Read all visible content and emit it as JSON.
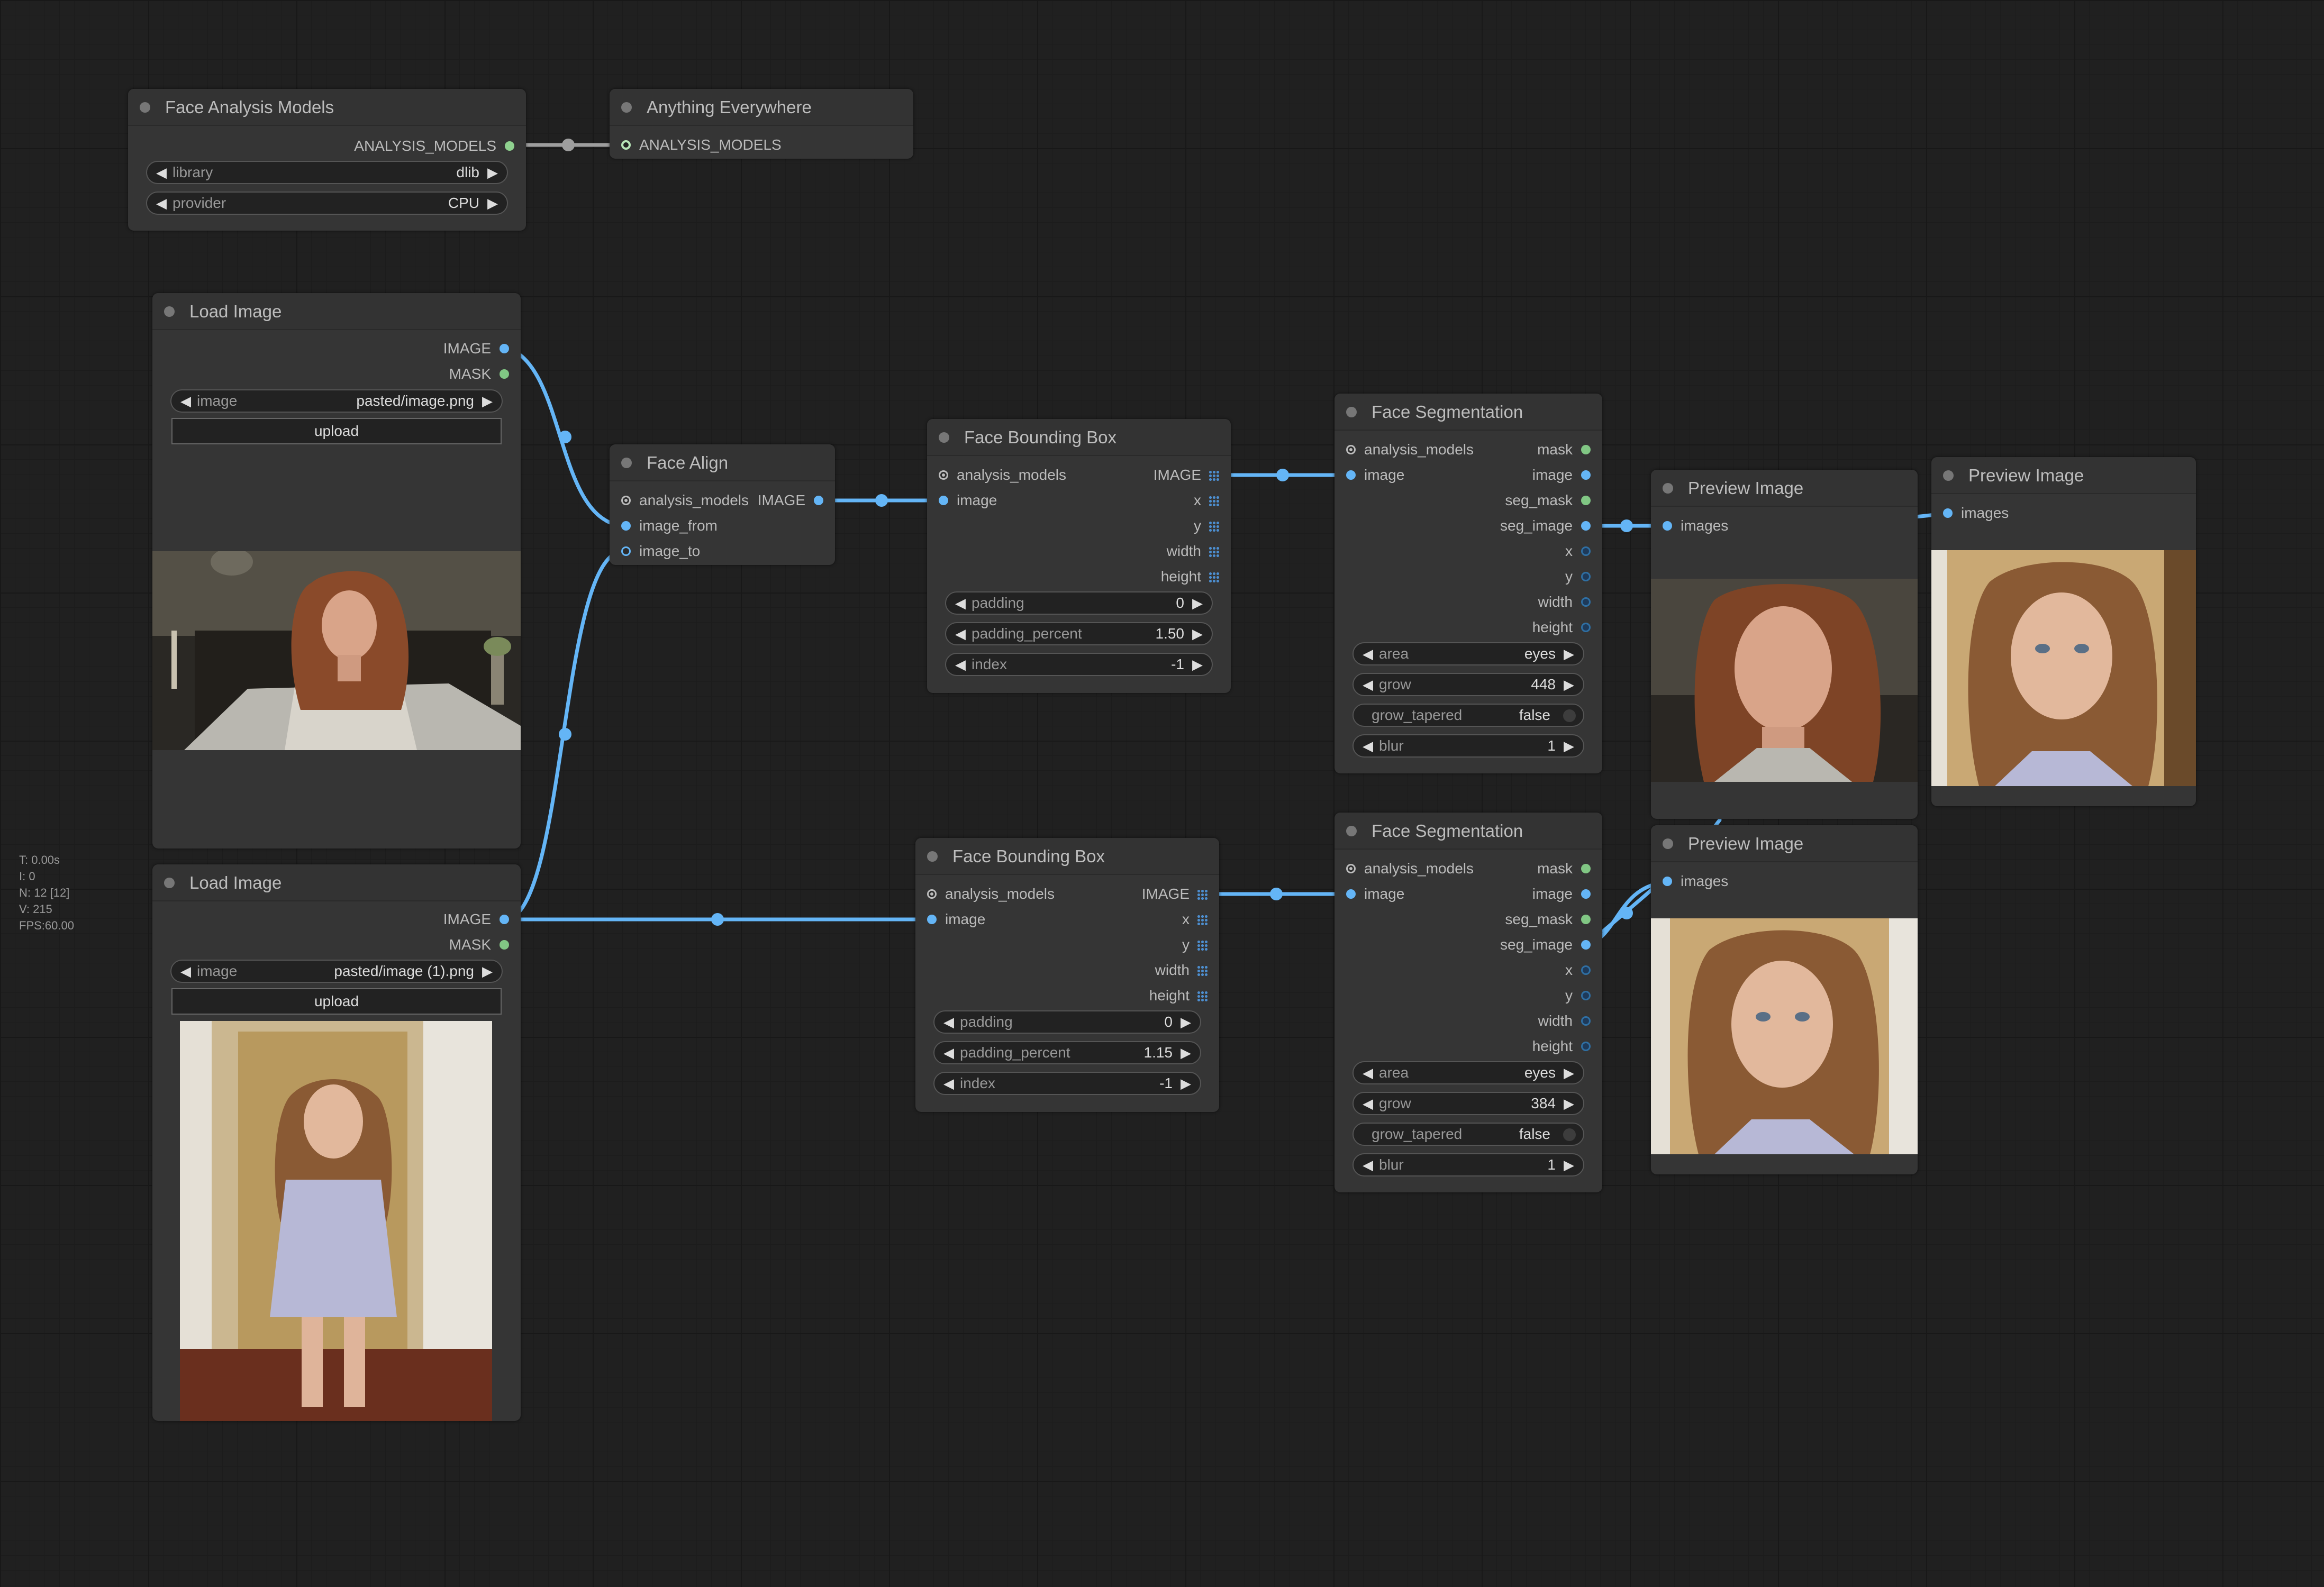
{
  "colors": {
    "canvas": "#202020",
    "node": "#353535",
    "link": "#64b5f6",
    "model_link": "#9e9e9e",
    "image_slot": "#64b5f6",
    "mask_slot": "#81c784"
  },
  "stats": {
    "t": "T: 0.00s",
    "i": "I: 0",
    "n": "N: 12 [12]",
    "v": "V: 215",
    "fps": "FPS:60.00"
  },
  "nodes": {
    "face_models": {
      "title": "Face Analysis Models",
      "output": "ANALYSIS_MODELS",
      "library_label": "library",
      "library_value": "dlib",
      "provider_label": "provider",
      "provider_value": "CPU"
    },
    "anything": {
      "title": "Anything Everywhere",
      "input": "ANALYSIS_MODELS"
    },
    "load1": {
      "title": "Load Image",
      "out_image": "IMAGE",
      "out_mask": "MASK",
      "image_label": "image",
      "image_value": "pasted/image.png",
      "upload": "upload"
    },
    "load2": {
      "title": "Load Image",
      "out_image": "IMAGE",
      "out_mask": "MASK",
      "image_label": "image",
      "image_value": "pasted/image (1).png",
      "upload": "upload"
    },
    "align": {
      "title": "Face Align",
      "in_models": "analysis_models",
      "in_from": "image_from",
      "in_to": "image_to",
      "out_image": "IMAGE"
    },
    "bbox1": {
      "title": "Face Bounding Box",
      "in_models": "analysis_models",
      "in_image": "image",
      "out_image": "IMAGE",
      "out_x": "x",
      "out_y": "y",
      "out_w": "width",
      "out_h": "height",
      "padding_label": "padding",
      "padding_value": "0",
      "pp_label": "padding_percent",
      "pp_value": "1.50",
      "index_label": "index",
      "index_value": "-1"
    },
    "bbox2": {
      "title": "Face Bounding Box",
      "in_models": "analysis_models",
      "in_image": "image",
      "out_image": "IMAGE",
      "out_x": "x",
      "out_y": "y",
      "out_w": "width",
      "out_h": "height",
      "padding_label": "padding",
      "padding_value": "0",
      "pp_label": "padding_percent",
      "pp_value": "1.15",
      "index_label": "index",
      "index_value": "-1"
    },
    "seg1": {
      "title": "Face Segmentation",
      "in_models": "analysis_models",
      "in_image": "image",
      "out_mask": "mask",
      "out_image": "image",
      "out_seg_mask": "seg_mask",
      "out_seg_image": "seg_image",
      "out_x": "x",
      "out_y": "y",
      "out_w": "width",
      "out_h": "height",
      "area_label": "area",
      "area_value": "eyes",
      "grow_label": "grow",
      "grow_value": "448",
      "tapered_label": "grow_tapered",
      "tapered_value": "false",
      "blur_label": "blur",
      "blur_value": "1"
    },
    "seg2": {
      "title": "Face Segmentation",
      "in_models": "analysis_models",
      "in_image": "image",
      "out_mask": "mask",
      "out_image": "image",
      "out_seg_mask": "seg_mask",
      "out_seg_image": "seg_image",
      "out_x": "x",
      "out_y": "y",
      "out_w": "width",
      "out_h": "height",
      "area_label": "area",
      "area_value": "eyes",
      "grow_label": "grow",
      "grow_value": "384",
      "tapered_label": "grow_tapered",
      "tapered_value": "false",
      "blur_label": "blur",
      "blur_value": "1"
    },
    "prev1": {
      "title": "Preview Image",
      "in_images": "images"
    },
    "prev2": {
      "title": "Preview Image",
      "in_images": "images"
    },
    "prev3": {
      "title": "Preview Image",
      "in_images": "images"
    }
  }
}
